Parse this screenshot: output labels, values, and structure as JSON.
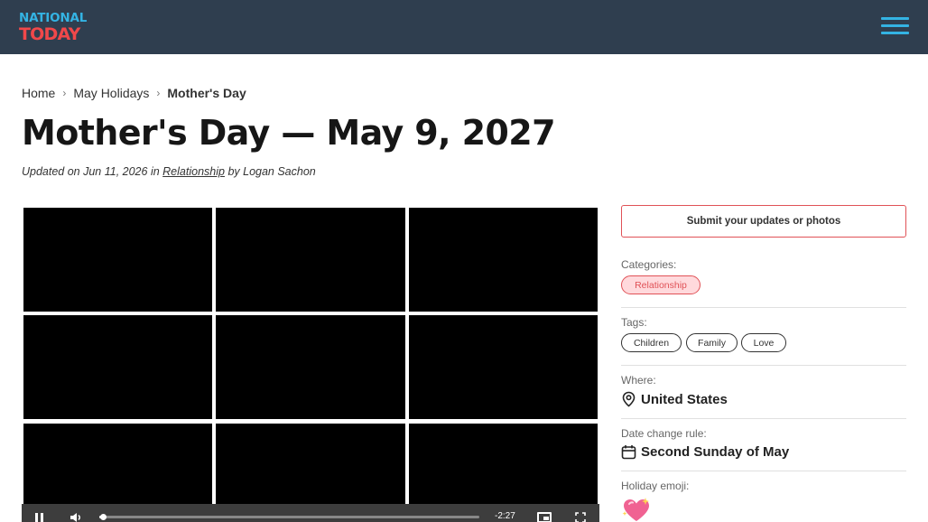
{
  "header": {
    "logo_line1": "NATIONAL",
    "logo_line2": "TODAY",
    "menu_icon": "hamburger-menu-icon",
    "colors": {
      "bar": "#2f3e4f",
      "accent_blue": "#34b3e3",
      "accent_red": "#f0484a"
    }
  },
  "breadcrumb": {
    "items": [
      "Home",
      "May Holidays"
    ],
    "current": "Mother's Day",
    "separator": "›"
  },
  "page": {
    "title": "Mother's Day — May 9, 2027",
    "meta": {
      "updated_prefix": "Updated on Jun 11, 2026 in",
      "category_link": "Relationship",
      "author": "by Logan Sachon"
    }
  },
  "video": {
    "time_remaining": "-2:27",
    "progress_fraction": 0.01,
    "icons": [
      "pause-icon",
      "volume-icon",
      "picture-in-picture-icon",
      "fullscreen-icon"
    ]
  },
  "sidebar": {
    "submit_label": "Submit your updates or photos",
    "categories_label": "Categories:",
    "categories": [
      "Relationship"
    ],
    "tags_label": "Tags:",
    "tags": [
      "Children",
      "Family",
      "Love"
    ],
    "where_label": "Where:",
    "where_value": "United States",
    "date_rule_label": "Date change rule:",
    "date_rule_value": "Second Sunday of May",
    "emoji_label": "Holiday emoji:",
    "emoji_icon": "sparkling-heart-icon",
    "accent": "#e05257"
  }
}
